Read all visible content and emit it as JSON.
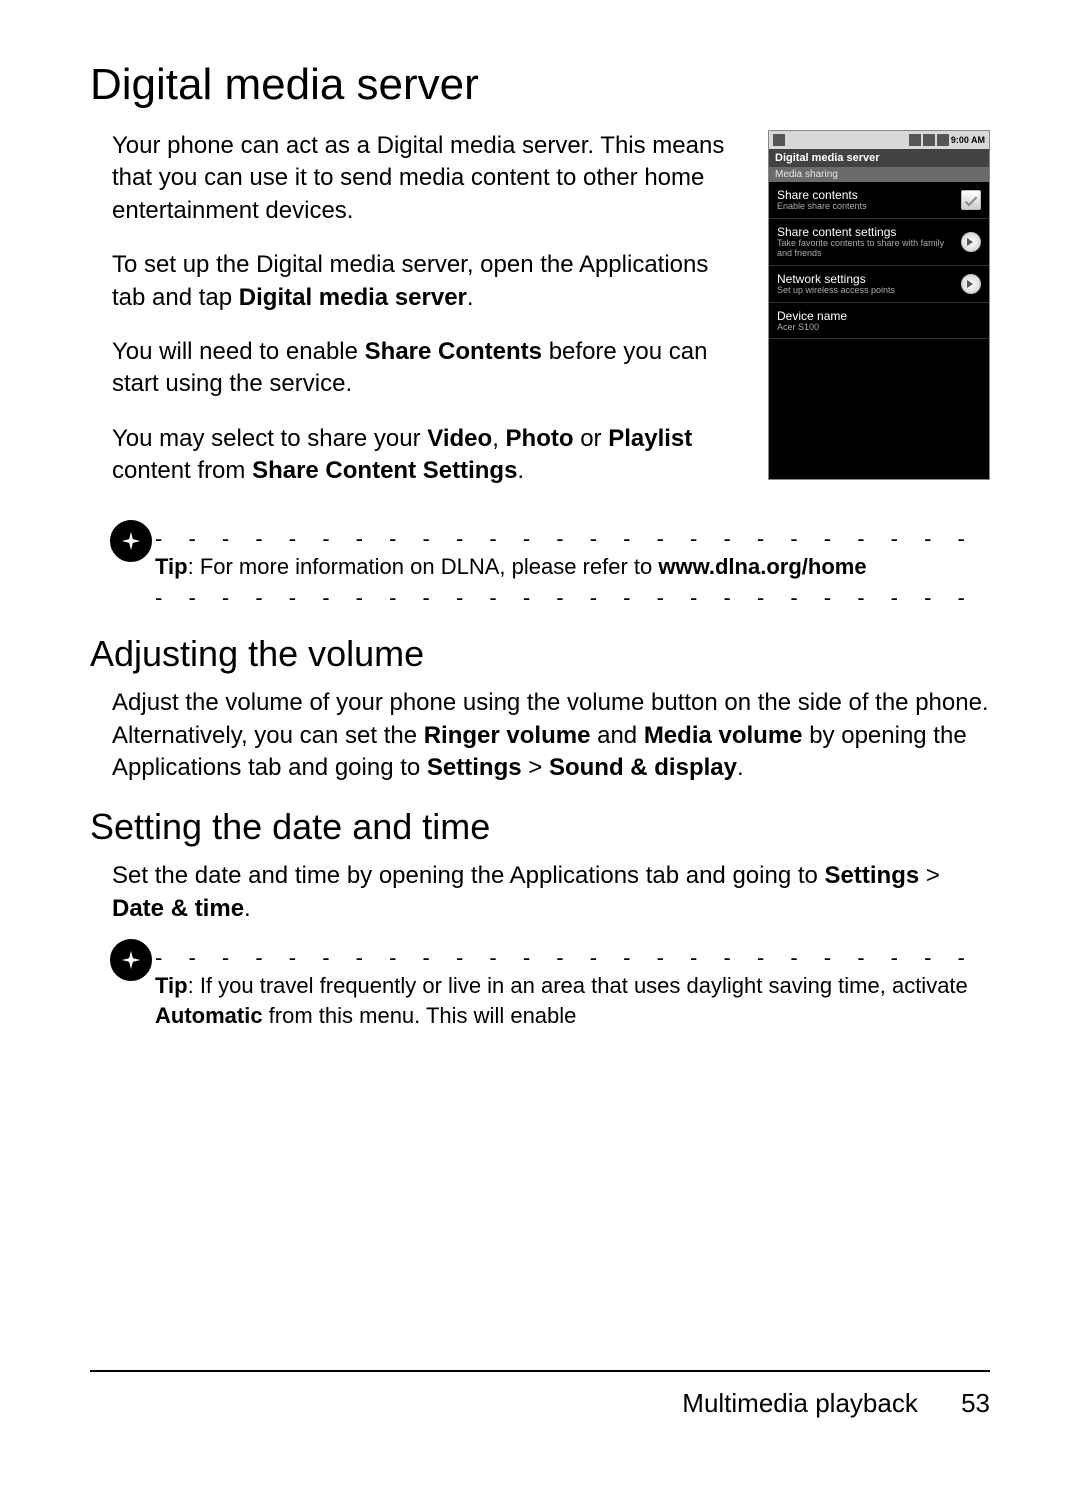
{
  "headings": {
    "h1": "Digital media server",
    "h2a": "Adjusting the volume",
    "h2b": "Setting the date and time"
  },
  "paras": {
    "p1": "Your phone can act as a Digital media server. This means that you can use it to send media content to other home entertainment devices.",
    "p2_a": "To set up the Digital media server, open the Applications tab and tap ",
    "p2_b": "Digital media server",
    "p2_c": ".",
    "p3_a": "You will need to enable ",
    "p3_b": "Share Contents",
    "p3_c": " before you can start using the service.",
    "p4_a": "You may select to share your ",
    "p4_b": "Video",
    "p4_c": ", ",
    "p4_d": "Photo",
    "p4_e": " or ",
    "p4_f": "Playlist",
    "p4_g": " content from ",
    "p4_h": "Share Content Settings",
    "p4_i": ".",
    "vol_a": "Adjust the volume of your phone using the volume button on the side of the phone. Alternatively, you can set the ",
    "vol_b": "Ringer volume",
    "vol_c": " and ",
    "vol_d": "Media volume",
    "vol_e": " by opening the Applications tab and going to ",
    "vol_f": "Settings",
    "vol_g": " > ",
    "vol_h": "Sound & display",
    "vol_i": ".",
    "dt_a": "Set the date and time by opening the Applications tab and going to ",
    "dt_b": "Settings",
    "dt_c": " > ",
    "dt_d": "Date & time",
    "dt_e": "."
  },
  "tips": {
    "t1_label": "Tip",
    "t1_a": ": For more information on DLNA, please refer to ",
    "t1_b": "www.dlna.org/home",
    "t2_label": "Tip",
    "t2_a": ": If you travel frequently or live in an area that uses daylight saving time, activate ",
    "t2_b": "Automatic",
    "t2_c": " from this menu. This will enable"
  },
  "phone": {
    "time": "9:00 AM",
    "title": "Digital media server",
    "section": "Media sharing",
    "rows": [
      {
        "title": "Share contents",
        "sub": "Enable share contents",
        "ctrl": "checkbox"
      },
      {
        "title": "Share content settings",
        "sub": "Take favorite contents to share with family and friends",
        "ctrl": "chev"
      },
      {
        "title": "Network settings",
        "sub": "Set up wireless access points",
        "ctrl": "chev"
      },
      {
        "title": "Device name",
        "sub": "Acer S100",
        "ctrl": ""
      }
    ]
  },
  "footer": {
    "section": "Multimedia playback",
    "page": "53"
  },
  "dash": "- - - - - - - - - - - - - - - - - - - - - - - - - - - - - - - - - - - - - - -"
}
